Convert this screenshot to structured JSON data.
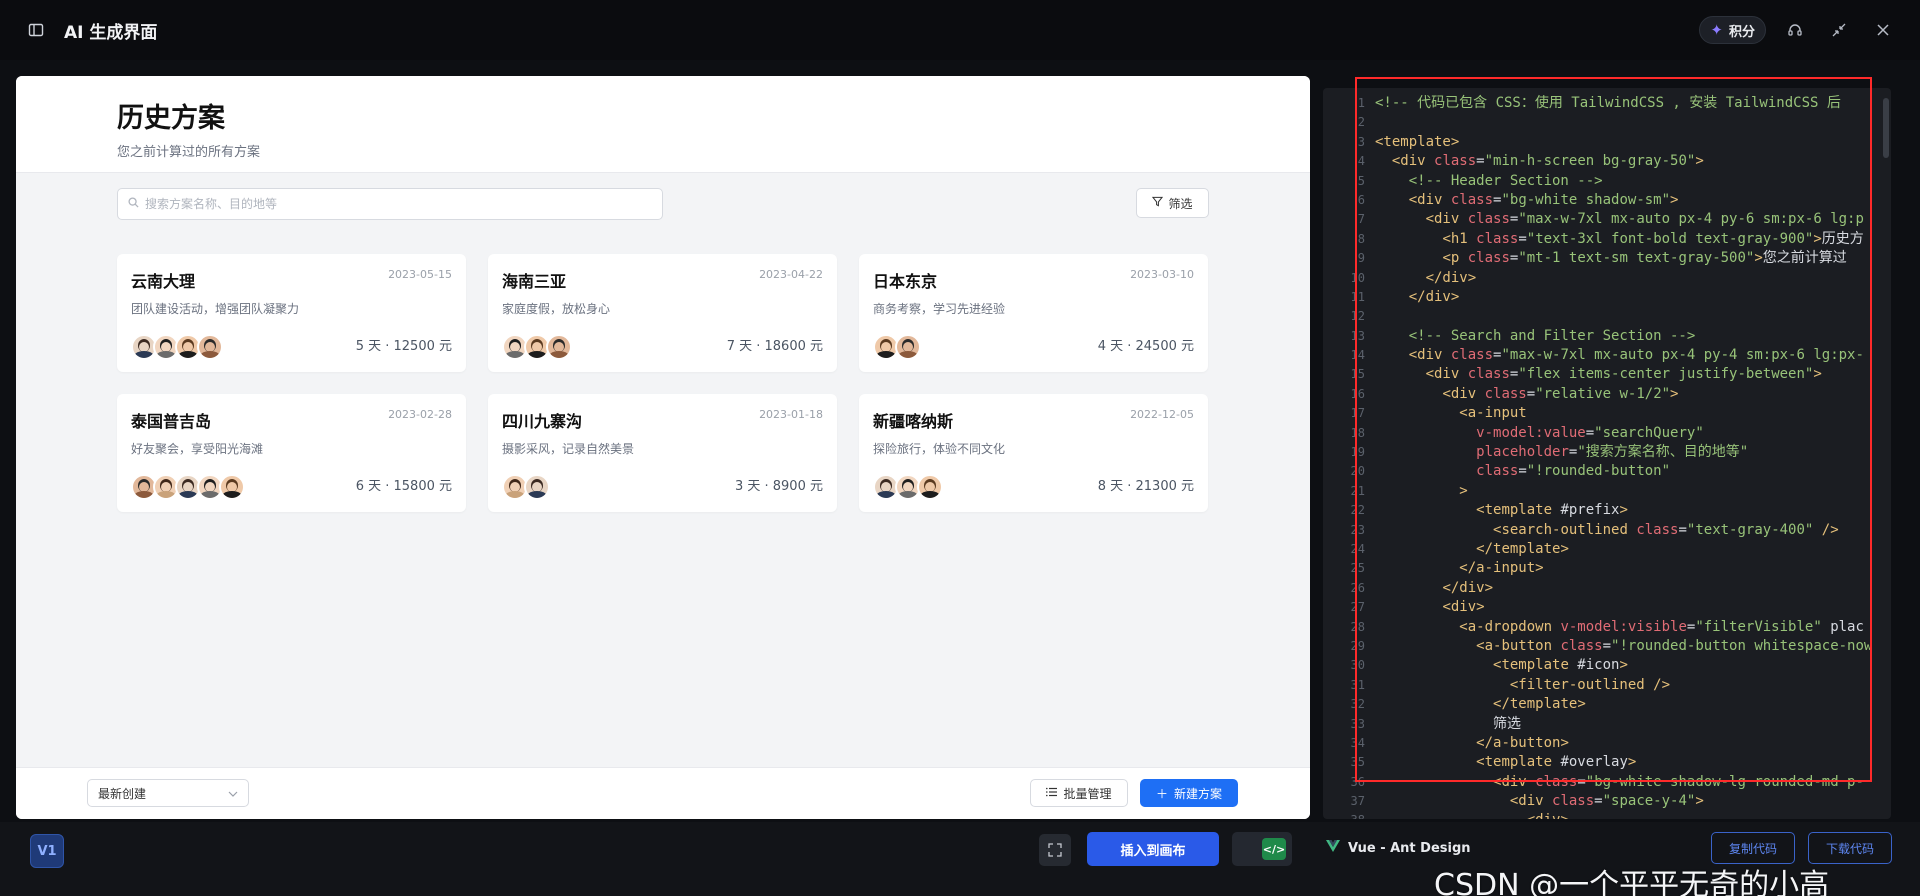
{
  "app": {
    "title": "AI 生成界面",
    "points_label": "积分"
  },
  "preview": {
    "title": "历史方案",
    "subtitle": "您之前计算过的所有方案",
    "search": {
      "placeholder": "搜索方案名称、目的地等",
      "value": ""
    },
    "filter_label": "筛选",
    "cards": [
      {
        "name": "云南大理",
        "date": "2023-05-15",
        "desc": "团队建设活动，增强团队凝聚力",
        "meta": "5 天 · 12500 元",
        "avatar_count": 4
      },
      {
        "name": "海南三亚",
        "date": "2023-04-22",
        "desc": "家庭度假，放松身心",
        "meta": "7 天 · 18600 元",
        "avatar_count": 3
      },
      {
        "name": "日本东京",
        "date": "2023-03-10",
        "desc": "商务考察，学习先进经验",
        "meta": "4 天 · 24500 元",
        "avatar_count": 2
      },
      {
        "name": "泰国普吉岛",
        "date": "2023-02-28",
        "desc": "好友聚会，享受阳光海滩",
        "meta": "6 天 · 15800 元",
        "avatar_count": 5
      },
      {
        "name": "四川九寨沟",
        "date": "2023-01-18",
        "desc": "摄影采风，记录自然美景",
        "meta": "3 天 · 8900 元",
        "avatar_count": 2
      },
      {
        "name": "新疆喀纳斯",
        "date": "2022-12-05",
        "desc": "探险旅行，体验不同文化",
        "meta": "8 天 · 21300 元",
        "avatar_count": 3
      }
    ],
    "sort_value": "最新创建",
    "batch_label": "批量管理",
    "new_label": "新建方案"
  },
  "code": {
    "lines": [
      "<!-- 代码已包含 CSS：使用 TailwindCSS , 安装 TailwindCSS 后",
      "",
      "<template>",
      "  <div class=\"min-h-screen bg-gray-50\">",
      "    <!-- Header Section -->",
      "    <div class=\"bg-white shadow-sm\">",
      "      <div class=\"max-w-7xl mx-auto px-4 py-6 sm:px-6 lg:p",
      "        <h1 class=\"text-3xl font-bold text-gray-900\">历史方",
      "        <p class=\"mt-1 text-sm text-gray-500\">您之前计算过",
      "      </div>",
      "    </div>",
      "",
      "    <!-- Search and Filter Section -->",
      "    <div class=\"max-w-7xl mx-auto px-4 py-4 sm:px-6 lg:px-",
      "      <div class=\"flex items-center justify-between\">",
      "        <div class=\"relative w-1/2\">",
      "          <a-input",
      "            v-model:value=\"searchQuery\"",
      "            placeholder=\"搜索方案名称、目的地等\"",
      "            class=\"!rounded-button\"",
      "          >",
      "            <template #prefix>",
      "              <search-outlined class=\"text-gray-400\" />",
      "            </template>",
      "          </a-input>",
      "        </div>",
      "        <div>",
      "          <a-dropdown v-model:visible=\"filterVisible\" plac",
      "            <a-button class=\"!rounded-button whitespace-now",
      "              <template #icon>",
      "                <filter-outlined />",
      "              </template>",
      "              筛选",
      "            </a-button>",
      "            <template #overlay>",
      "              <div class=\"bg-white shadow-lg rounded-md p-",
      "                <div class=\"space-y-4\">",
      "                  <div>"
    ]
  },
  "bottom": {
    "version": "V1",
    "insert_label": "插入到画布",
    "framework": "Vue - Ant Design",
    "copy_label": "复制代码",
    "download_label": "下载代码",
    "watermark": "CSDN @一个平平无奇的小高"
  },
  "colors": {
    "primary": "#1e6ff5",
    "insert": "#2a5ae8",
    "highlight_box": "#ff2a2a"
  }
}
